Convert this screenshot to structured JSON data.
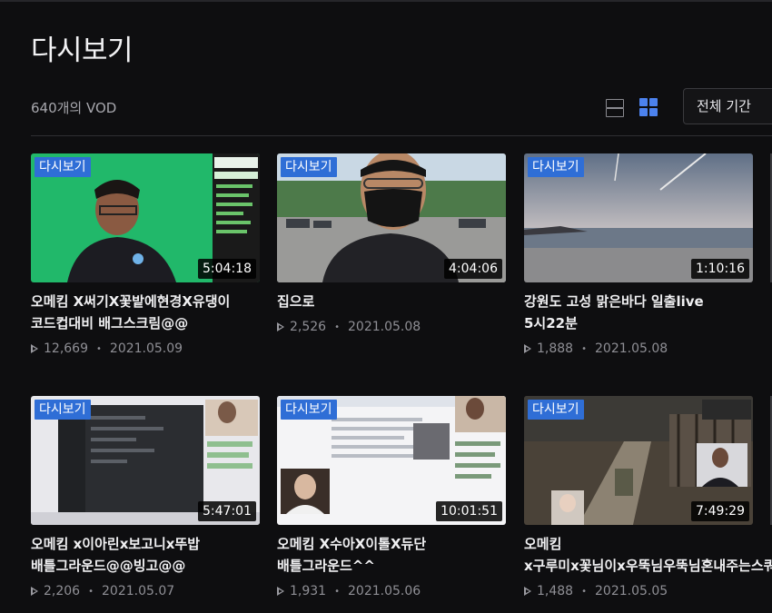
{
  "page": {
    "title": "다시보기",
    "vod_count": "640개의 VOD",
    "period_filter": "전체 기간"
  },
  "colors": {
    "background": "#0e0e10",
    "badge": "#2f6ed6",
    "active_view_icon": "#4c82ee"
  },
  "view_toggle": {
    "options": [
      "list-view-icon",
      "grid-view-icon"
    ],
    "active": "grid-view-icon"
  },
  "videos": [
    {
      "badge": "다시보기",
      "duration": "5:04:18",
      "title": "오메킴 X써기X꽃밭에현경X유댕이 코드컵대비 배그스크림@@",
      "views": "12,669",
      "date": "2021.05.09"
    },
    {
      "badge": "다시보기",
      "duration": "4:04:06",
      "title": "집으로",
      "views": "2,526",
      "date": "2021.05.08"
    },
    {
      "badge": "다시보기",
      "duration": "1:10:16",
      "title": "강원도 고성 맑은바다 일출live 5시22분",
      "views": "1,888",
      "date": "2021.05.08"
    },
    {
      "badge": "다시보기",
      "duration": "5:47:01",
      "title": "오메킴 x이아린x보고니x뚜밥 배틀그라운드@@빙고@@",
      "views": "2,206",
      "date": "2021.05.07"
    },
    {
      "badge": "다시보기",
      "duration": "10:01:51",
      "title": "오메킴 X수아X이톨X듀단 배틀그라운드^^",
      "views": "1,931",
      "date": "2021.05.06"
    },
    {
      "badge": "다시보기",
      "duration": "7:49:29",
      "title": "오메킴 x구루미x꽃님이x우뚝님우뚝님혼내주는스쿼드",
      "views": "1,488",
      "date": "2021.05.05"
    }
  ]
}
